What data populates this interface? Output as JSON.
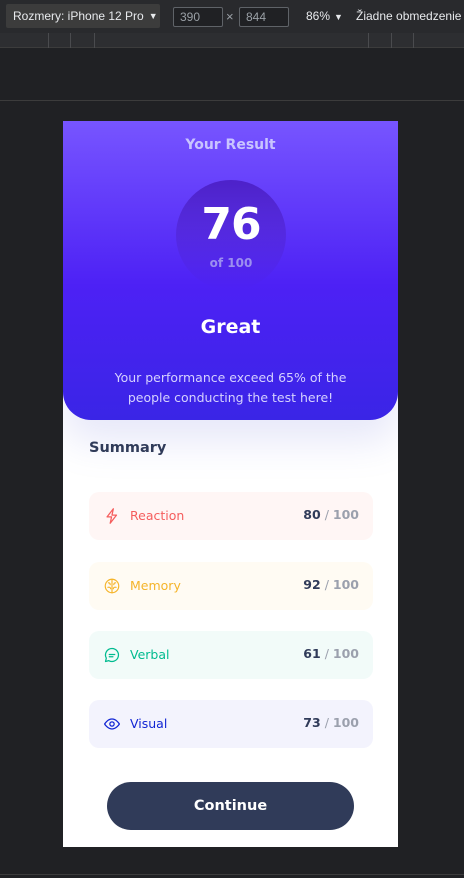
{
  "devtools": {
    "device_label": "Rozmery: iPhone 12 Pro",
    "width": "390",
    "height": "844",
    "times_symbol": "×",
    "zoom": "86%",
    "throttling": "Žiadne obmedzenie"
  },
  "result": {
    "heading": "Your Result",
    "score": "76",
    "out_of": "of 100",
    "rating": "Great",
    "description": "Your performance exceed 65% of the people conducting the test here!"
  },
  "summary": {
    "title": "Summary",
    "items": [
      {
        "label": "Reaction",
        "score": "80",
        "max": "100",
        "icon": "lightning-icon",
        "color": "#f55d5d",
        "bg": "#fff6f5"
      },
      {
        "label": "Memory",
        "score": "92",
        "max": "100",
        "icon": "brain-icon",
        "color": "#f5b429",
        "bg": "#fffbf3"
      },
      {
        "label": "Verbal",
        "score": "61",
        "max": "100",
        "icon": "chat-bubble-icon",
        "color": "#00bb8f",
        "bg": "#f2fbf9"
      },
      {
        "label": "Visual",
        "score": "73",
        "max": "100",
        "icon": "eye-icon",
        "color": "#1125d4",
        "bg": "#f3f3fd"
      }
    ],
    "separator": "/"
  },
  "actions": {
    "continue_label": "Continue"
  }
}
